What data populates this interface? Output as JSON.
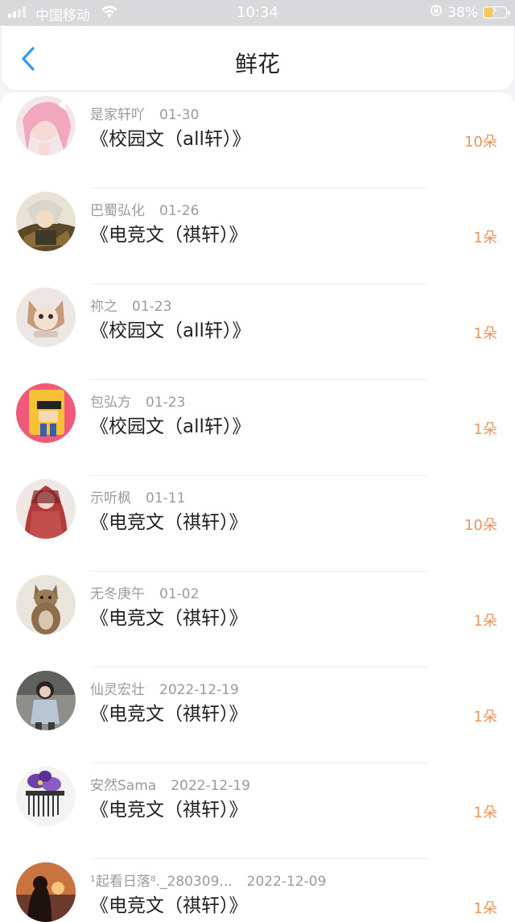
{
  "status_bar": {
    "carrier": "中国移动",
    "time": "10:34",
    "battery_percent": "38%",
    "battery_level": 0.38
  },
  "header": {
    "title": "鲜花",
    "back_icon": "chevron-left-icon",
    "accent_color": "#2f9bea"
  },
  "flower_records": [
    {
      "user": "是家轩吖",
      "date": "01-30",
      "work": "《校园文（all轩）》",
      "count": "10朵"
    },
    {
      "user": "巴蜀弘化",
      "date": "01-26",
      "work": "《电竞文（祺轩）》",
      "count": "1朵"
    },
    {
      "user": "祢之",
      "date": "01-23",
      "work": "《校园文（all轩）》",
      "count": "1朵"
    },
    {
      "user": "包弘方",
      "date": "01-23",
      "work": "《校园文（all轩）》",
      "count": "1朵"
    },
    {
      "user": "示听枫",
      "date": "01-11",
      "work": "《电竞文（祺轩）》",
      "count": "10朵"
    },
    {
      "user": "无冬庚午",
      "date": "01-02",
      "work": "《电竞文（祺轩）》",
      "count": "1朵"
    },
    {
      "user": "仙灵宏壮",
      "date": "2022-12-19",
      "work": "《电竞文（祺轩）》",
      "count": "1朵"
    },
    {
      "user": "安然Sama",
      "date": "2022-12-19",
      "work": "《电竞文（祺轩）》",
      "count": "1朵"
    },
    {
      "user": "¹起看日落⁸._280309...",
      "date": "2022-12-09",
      "work": "《电竞文（祺轩）》",
      "count": "1朵"
    }
  ],
  "colors": {
    "count": "#e9935a",
    "meta": "#9a9a9a",
    "title": "#222222"
  }
}
